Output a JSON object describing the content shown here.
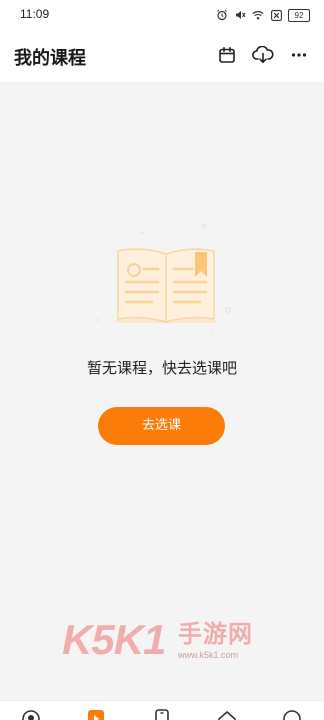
{
  "status_bar": {
    "time": "11:09",
    "icons": [
      "alarm-icon",
      "mute-icon",
      "wifi-icon",
      "sim-icon",
      "battery-icon"
    ],
    "battery_level": "92"
  },
  "header": {
    "title": "我的课程",
    "actions": [
      "calendar-icon",
      "cloud-download-icon",
      "more-icon"
    ]
  },
  "empty_state": {
    "illustration": "open-book-icon",
    "message": "暂无课程，快去选课吧",
    "button_label": "去选课"
  },
  "watermark": {
    "brand": "K5K1",
    "brand_cn": "手游网",
    "url": "www.k5k1.com"
  },
  "bottom_nav": {
    "items": [
      "home-icon",
      "course-icon",
      "phone-icon",
      "home-alt-icon",
      "profile-icon"
    ],
    "active_index": 1
  },
  "colors": {
    "accent": "#fb7c08",
    "background": "#f4f4f4",
    "surface": "#ffffff"
  }
}
